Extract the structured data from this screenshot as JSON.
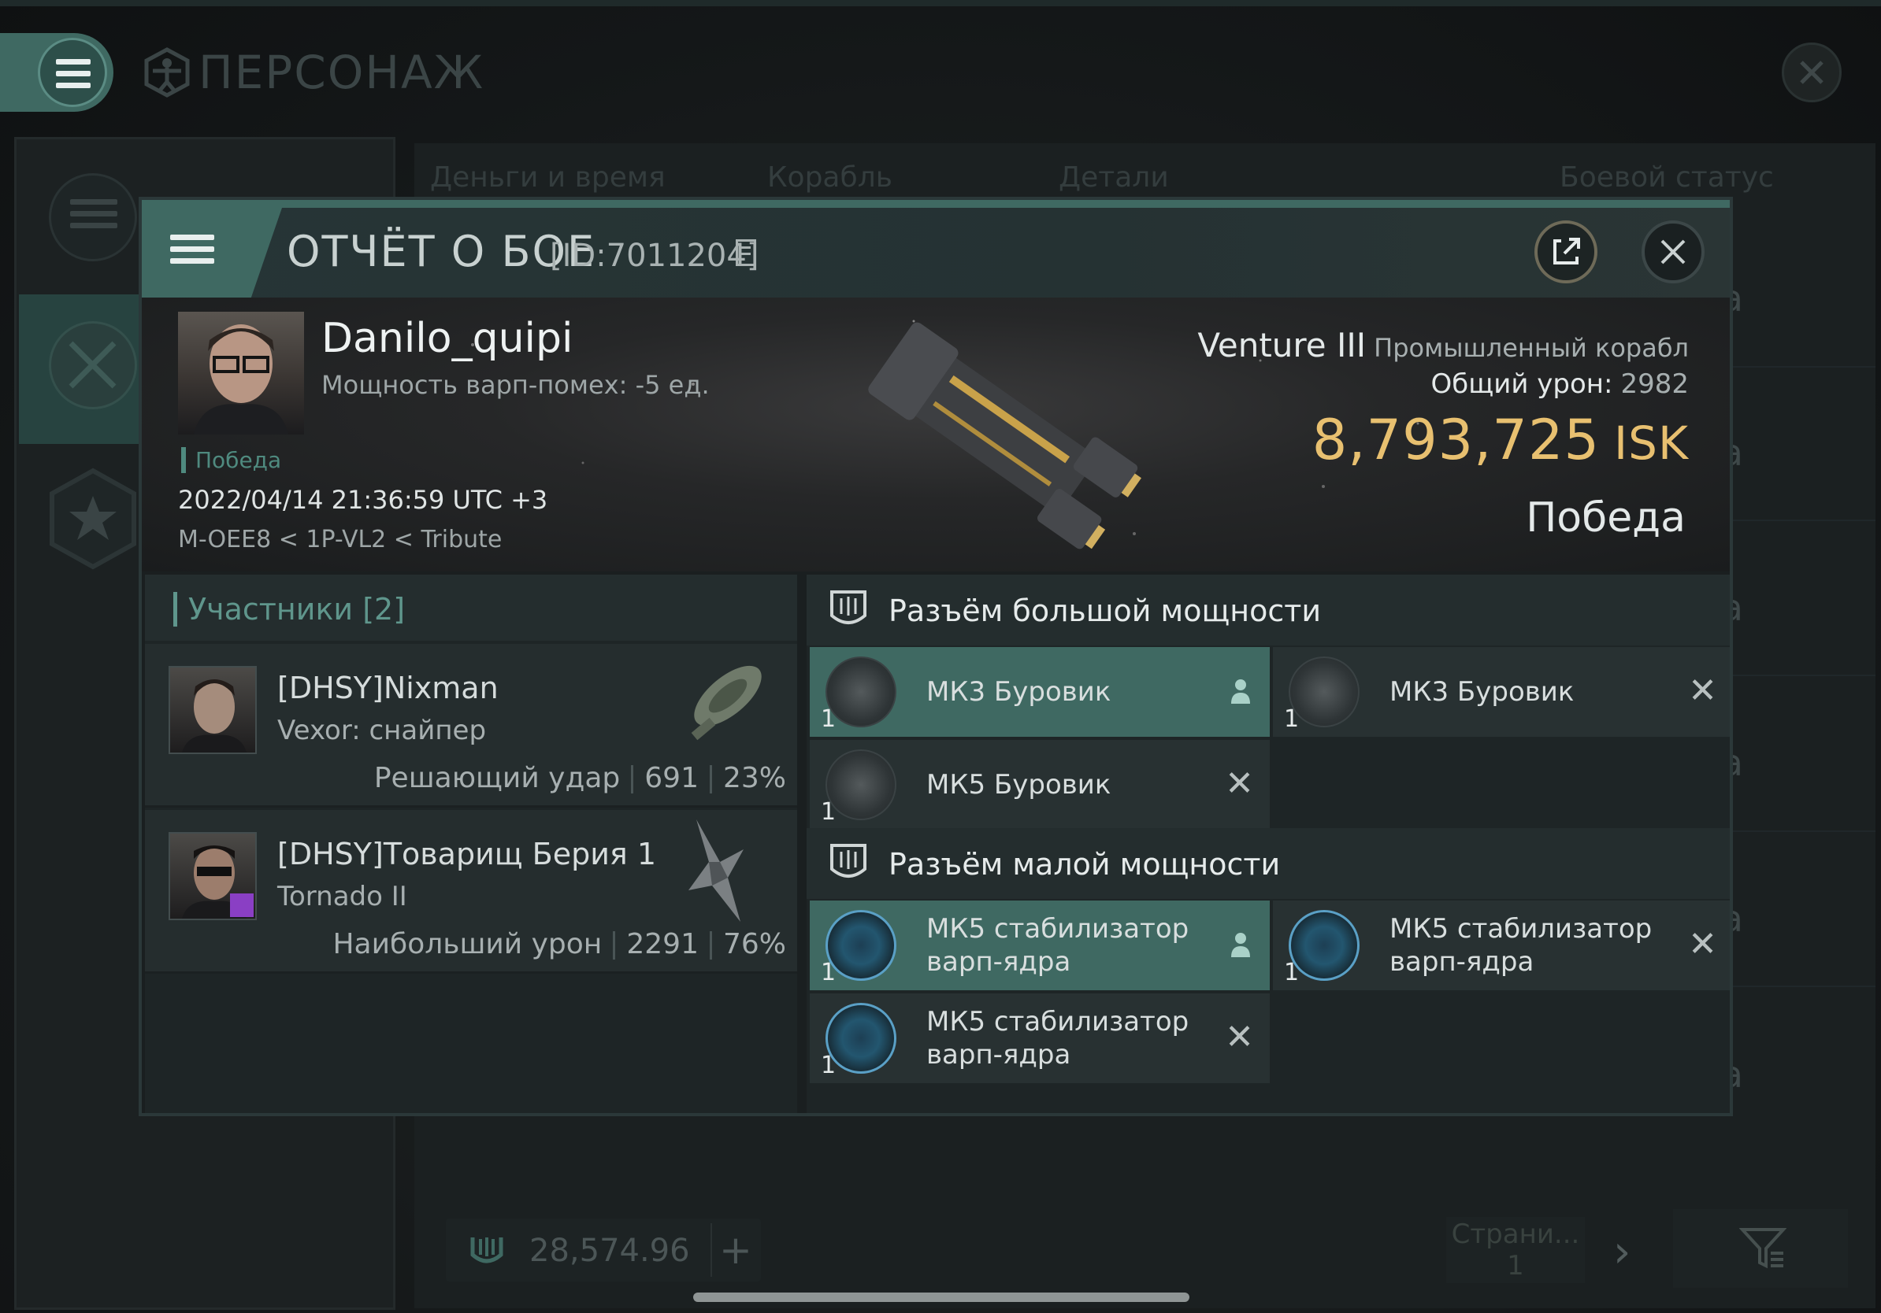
{
  "screen": {
    "title": "ПЕРСОНАЖ",
    "tabs": [
      "Деньги и время",
      "Корабль",
      "Детали",
      "Боевой статус"
    ],
    "row_status": [
      "да",
      "да",
      "да",
      "да",
      "да",
      "да"
    ],
    "wallet_amount": "28,574.96",
    "page_label": "Страни...",
    "page_number": "1"
  },
  "report": {
    "title": "ОТЧЁТ О БОЕ",
    "report_id": "[ID:7011204]",
    "victim": {
      "name": "Danilo_quipi",
      "warp_disrupt": "Мощность варп-помех: -5 ед.",
      "status": "Победа",
      "datetime": "2022/04/14 21:36:59 UTC +3",
      "location": "M-OEE8 < 1P-VL2 < Tribute"
    },
    "ship": {
      "name": "Venture III",
      "class": "Промышленный корабл",
      "total_damage_label": "Общий урон:",
      "total_damage": "2982",
      "isk_value": "8,793,725",
      "isk_unit": "ISK",
      "result": "Победа"
    }
  },
  "participants": {
    "title": "Участники [2]",
    "rows": [
      {
        "name": "[DHSY]Nixman",
        "ship": "Vexor: снайпер",
        "role": "Решающий удар",
        "damage": "691",
        "percent": "23%"
      },
      {
        "name": "[DHSY]Товарищ Берия 1",
        "ship": "Tornado II",
        "role": "Наибольший урон",
        "damage": "2291",
        "percent": "76%"
      }
    ]
  },
  "fitting": {
    "high_slots_title": "Разъём большой мощности",
    "low_slots_title": "Разъём малой мощности",
    "high": [
      {
        "name": "МК3 Буровик",
        "qty": "1",
        "state": "dropped"
      },
      {
        "name": "МК3 Буровик",
        "qty": "1",
        "state": "destroyed"
      },
      {
        "name": "МК5 Буровик",
        "qty": "1",
        "state": "destroyed"
      }
    ],
    "low": [
      {
        "name": "МК5 стабилизатор варп-ядра",
        "qty": "1",
        "state": "dropped"
      },
      {
        "name": "МК5 стабилизатор варп-ядра",
        "qty": "1",
        "state": "destroyed"
      },
      {
        "name": "МК5 стабилизатор варп-ядра",
        "qty": "1",
        "state": "destroyed"
      }
    ]
  },
  "colors": {
    "accent": "#3f6962",
    "isk": "#e8c070",
    "win": "#4f8a7f"
  },
  "icons": [
    "menu-icon",
    "vitruvian-icon",
    "close-icon",
    "external-link-icon",
    "copy-icon",
    "shield-slot-icon",
    "person-icon",
    "filter-icon",
    "star-icon",
    "crossed-swords-icon"
  ]
}
